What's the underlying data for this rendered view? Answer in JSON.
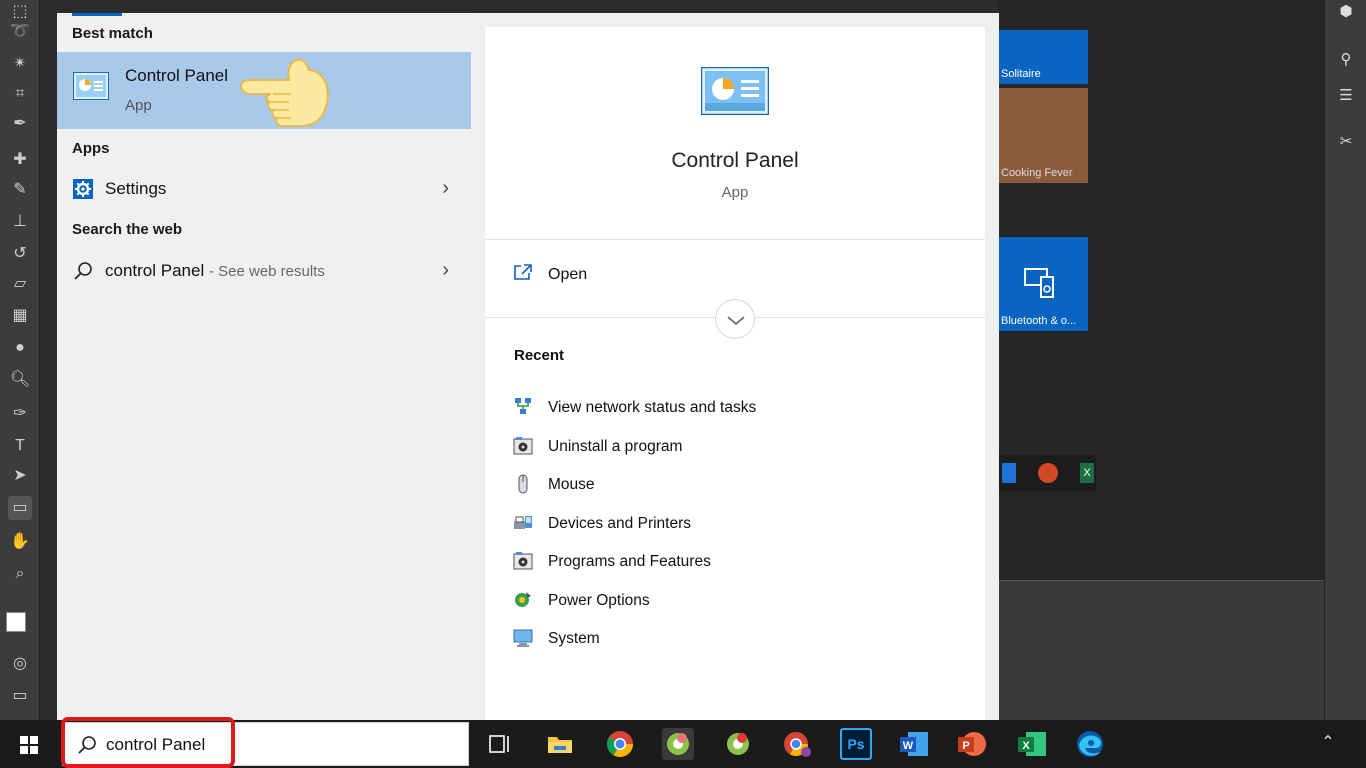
{
  "search": {
    "best_match_heading": "Best match",
    "best_match_title": "Control Panel",
    "best_match_type": "App",
    "apps_heading": "Apps",
    "apps": [
      {
        "label": "Settings",
        "icon": "gear-icon"
      }
    ],
    "web_heading": "Search the web",
    "web_query": "control Panel",
    "web_suffix": "- See web results",
    "query": "control Panel"
  },
  "details": {
    "title": "Control Panel",
    "type": "App",
    "open_label": "Open",
    "recent_heading": "Recent",
    "recent": [
      {
        "label": "View network status and tasks",
        "icon": "network-icon"
      },
      {
        "label": "Uninstall a program",
        "icon": "programs-icon"
      },
      {
        "label": "Mouse",
        "icon": "mouse-icon"
      },
      {
        "label": "Devices and Printers",
        "icon": "printer-icon"
      },
      {
        "label": "Programs and Features",
        "icon": "programs-icon"
      },
      {
        "label": "Power Options",
        "icon": "power-icon"
      },
      {
        "label": "System",
        "icon": "monitor-icon"
      }
    ]
  },
  "tiles": {
    "solitaire": "Solitaire",
    "cooking": "Cooking Fever",
    "bluetooth": "Bluetooth & o..."
  },
  "taskbar": {
    "apps": [
      "task-view",
      "file-explorer",
      "chrome",
      "chrome-profile",
      "chrome-profile-2",
      "chrome-profile-3",
      "photoshop",
      "word",
      "powerpoint",
      "excel",
      "edge"
    ],
    "accent_color": "#0a66c2",
    "highlight_color": "#e01a1a"
  }
}
